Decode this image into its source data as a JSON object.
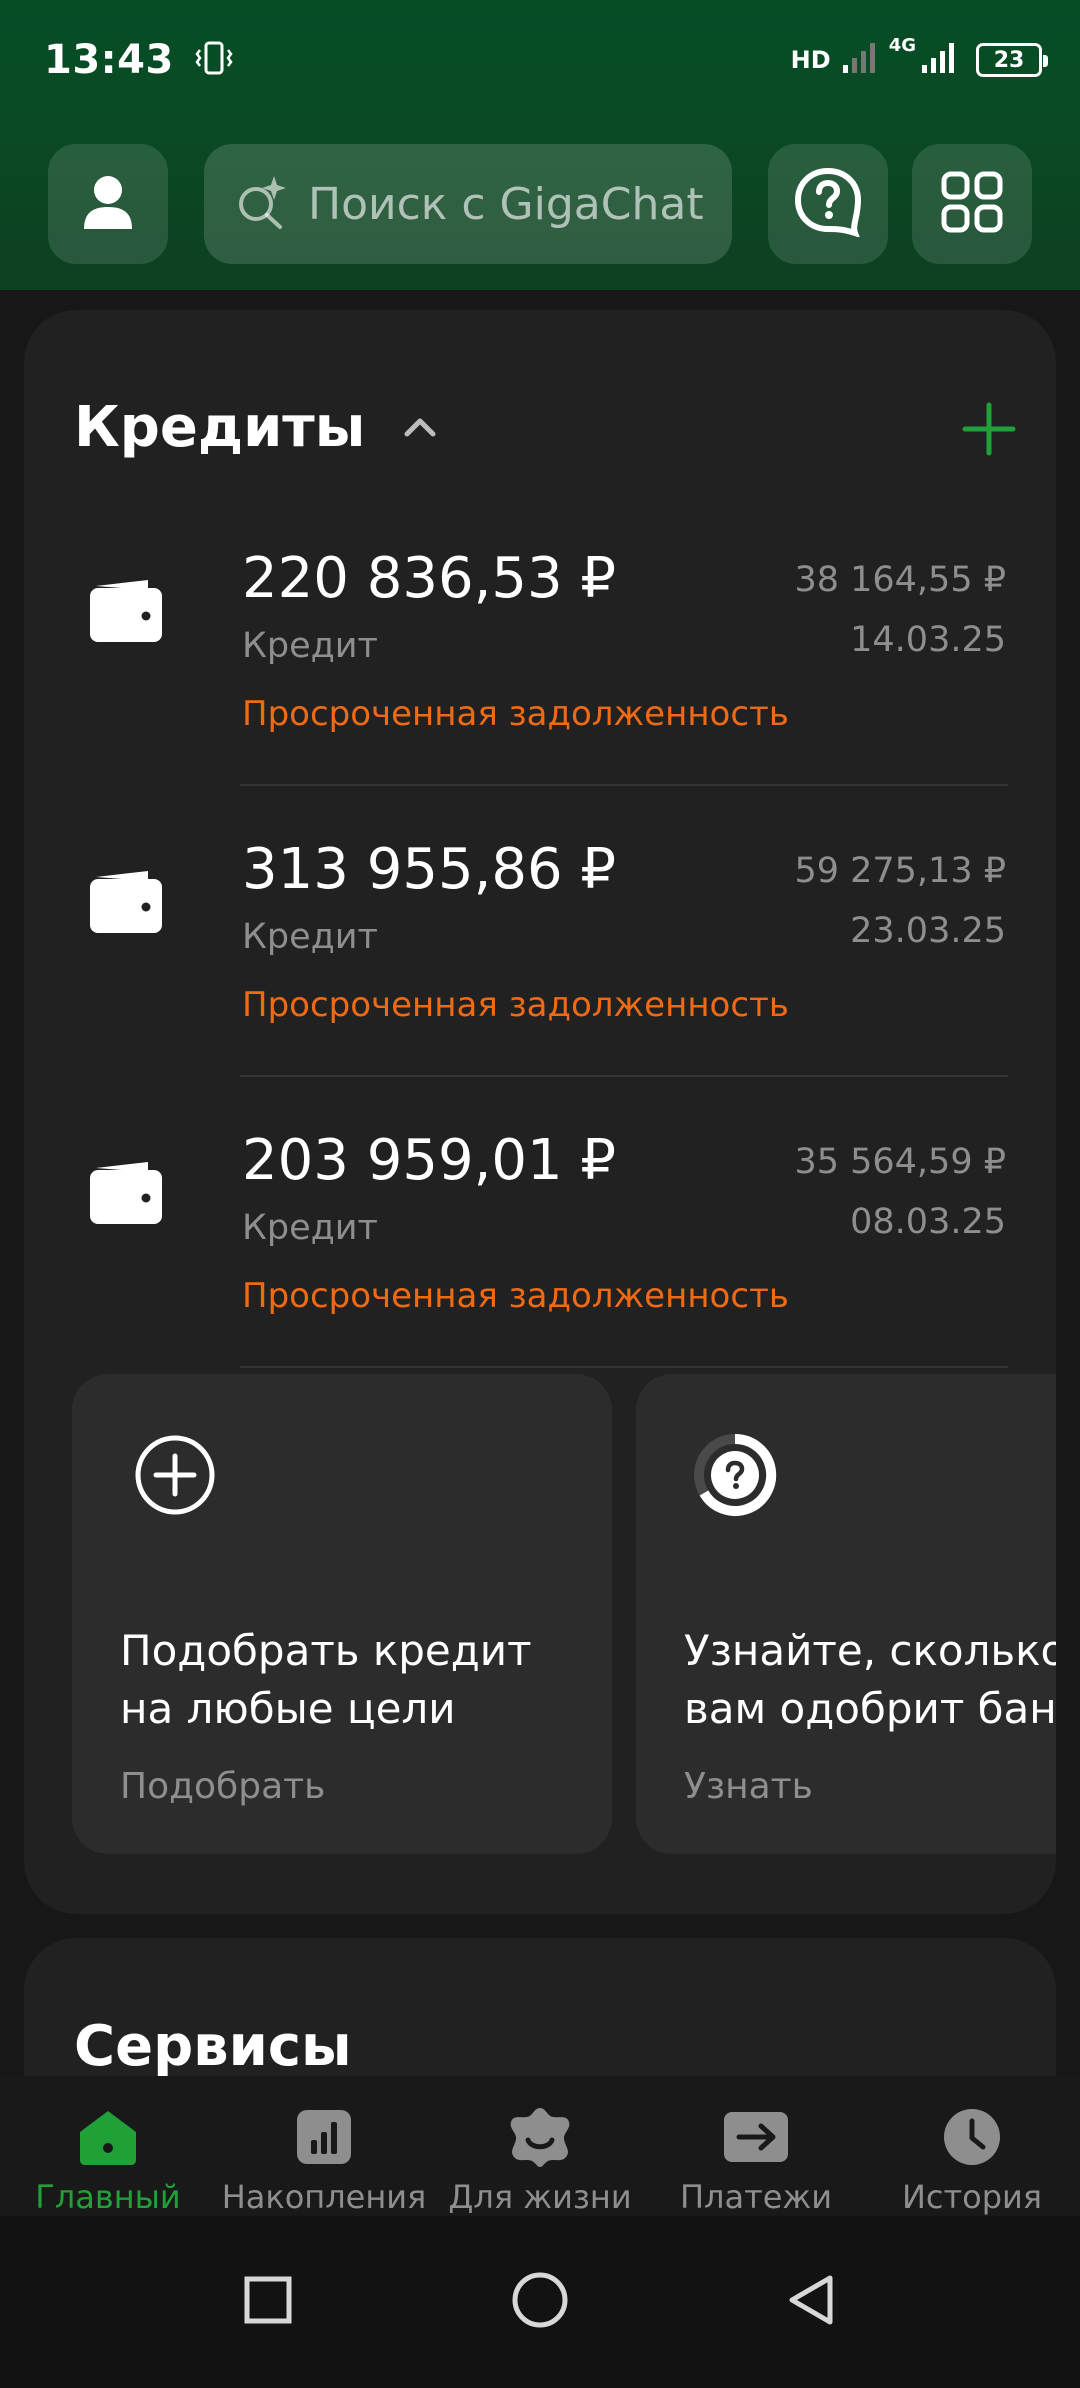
{
  "status_bar": {
    "time": "13:43",
    "network_hd": "HD",
    "network_4g": "4G",
    "battery": "23"
  },
  "header": {
    "search_placeholder": "Поиск с GigaChat"
  },
  "credits": {
    "title": "Кредиты",
    "loans": [
      {
        "amount": "220 836,53 ₽",
        "type": "Кредит",
        "status": "Просроченная задолженность",
        "payment": "38 164,55 ₽",
        "date": "14.03.25"
      },
      {
        "amount": "313 955,86 ₽",
        "type": "Кредит",
        "status": "Просроченная задолженность",
        "payment": "59 275,13 ₽",
        "date": "23.03.25"
      },
      {
        "amount": "203 959,01 ₽",
        "type": "Кредит",
        "status": "Просроченная задолженность",
        "payment": "35 564,59 ₽",
        "date": "08.03.25"
      }
    ],
    "offers": [
      {
        "title": "Подобрать кредит\nна любые цели",
        "link": "Подобрать",
        "icon": "plus-circle-icon"
      },
      {
        "title": "Узнайте, сколько\nвам одобрит банк",
        "link": "Узнать",
        "icon": "question-progress-icon"
      }
    ]
  },
  "services": {
    "title": "Сервисы"
  },
  "bottom_nav": {
    "items": [
      {
        "label": "Главный",
        "icon": "home-icon",
        "active": true
      },
      {
        "label": "Накопления",
        "icon": "chart-icon",
        "active": false
      },
      {
        "label": "Для жизни",
        "icon": "smile-star-icon",
        "active": false
      },
      {
        "label": "Платежи",
        "icon": "transfer-arrow-icon",
        "active": false
      },
      {
        "label": "История",
        "icon": "clock-icon",
        "active": false
      }
    ]
  },
  "colors": {
    "accent": "#21a038",
    "overdue": "#ef6a15",
    "muted": "#8e8e8e",
    "card": "#212121"
  }
}
